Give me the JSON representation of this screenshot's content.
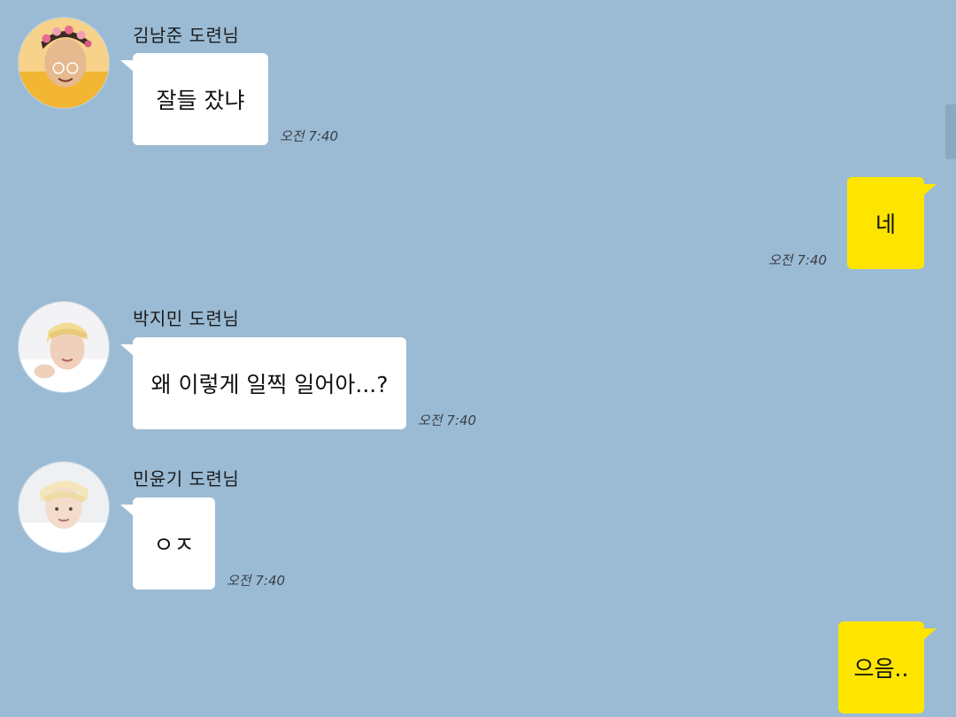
{
  "messages": [
    {
      "sender": "김남준 도련님",
      "text": "잘들 잤냐",
      "time": "오전 7:40",
      "direction": "incoming",
      "avatar_icon": "avatar-boy-flower-crown"
    },
    {
      "sender": "",
      "text": "네",
      "time": "오전 7:40",
      "direction": "outgoing"
    },
    {
      "sender": "박지민 도련님",
      "text": "왜 이렇게 일찍 일어아...?",
      "time": "오전 7:40",
      "direction": "incoming",
      "avatar_icon": "avatar-boy-blond"
    },
    {
      "sender": "민윤기 도련님",
      "text": "ㅇㅈ",
      "time": "오전 7:40",
      "direction": "incoming",
      "avatar_icon": "avatar-boy-light-hair"
    },
    {
      "sender": "",
      "text": "으음..",
      "time": "",
      "direction": "outgoing"
    }
  ],
  "colors": {
    "background": "#9bbbd4",
    "incoming_bubble": "#ffffff",
    "outgoing_bubble": "#fee500"
  }
}
